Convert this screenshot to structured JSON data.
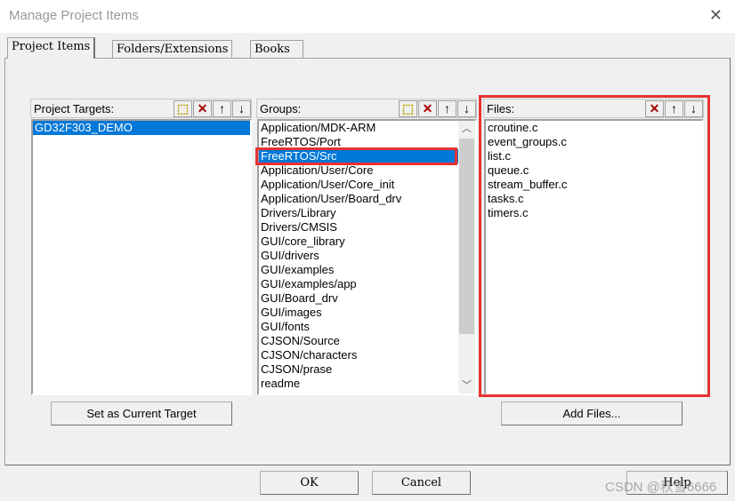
{
  "window": {
    "title": "Manage Project Items",
    "close_icon": "close-icon"
  },
  "tabs": [
    {
      "label": "Project Items",
      "active": true
    },
    {
      "label": "Folders/Extensions"
    },
    {
      "label": "Books"
    }
  ],
  "targets": {
    "header": "Project Targets:",
    "items": [
      "GD32F303_DEMO"
    ],
    "selected": 0
  },
  "groups": {
    "header": "Groups:",
    "items": [
      "Application/MDK-ARM",
      "FreeRTOS/Port",
      "FreeRTOS/Src",
      "Application/User/Core",
      "Application/User/Core_init",
      "Application/User/Board_drv",
      "Drivers/Library",
      "Drivers/CMSIS",
      "GUI/core_library",
      "GUI/drivers",
      "GUI/examples",
      "GUI/examples/app",
      "GUI/Board_drv",
      "GUI/images",
      "GUI/fonts",
      "CJSON/Source",
      "CJSON/characters",
      "CJSON/prase",
      "readme"
    ],
    "selected": 2
  },
  "files": {
    "header": "Files:",
    "items": [
      "croutine.c",
      "event_groups.c",
      "list.c",
      "queue.c",
      "stream_buffer.c",
      "tasks.c",
      "timers.c"
    ]
  },
  "buttons": {
    "set_target": "Set as Current Target",
    "add_files": "Add Files...",
    "ok": "OK",
    "cancel": "Cancel",
    "help": "Help"
  },
  "watermark": "CSDN @秋雪6666",
  "colors": {
    "selection": "#0078d7",
    "highlight": "#e83232"
  }
}
